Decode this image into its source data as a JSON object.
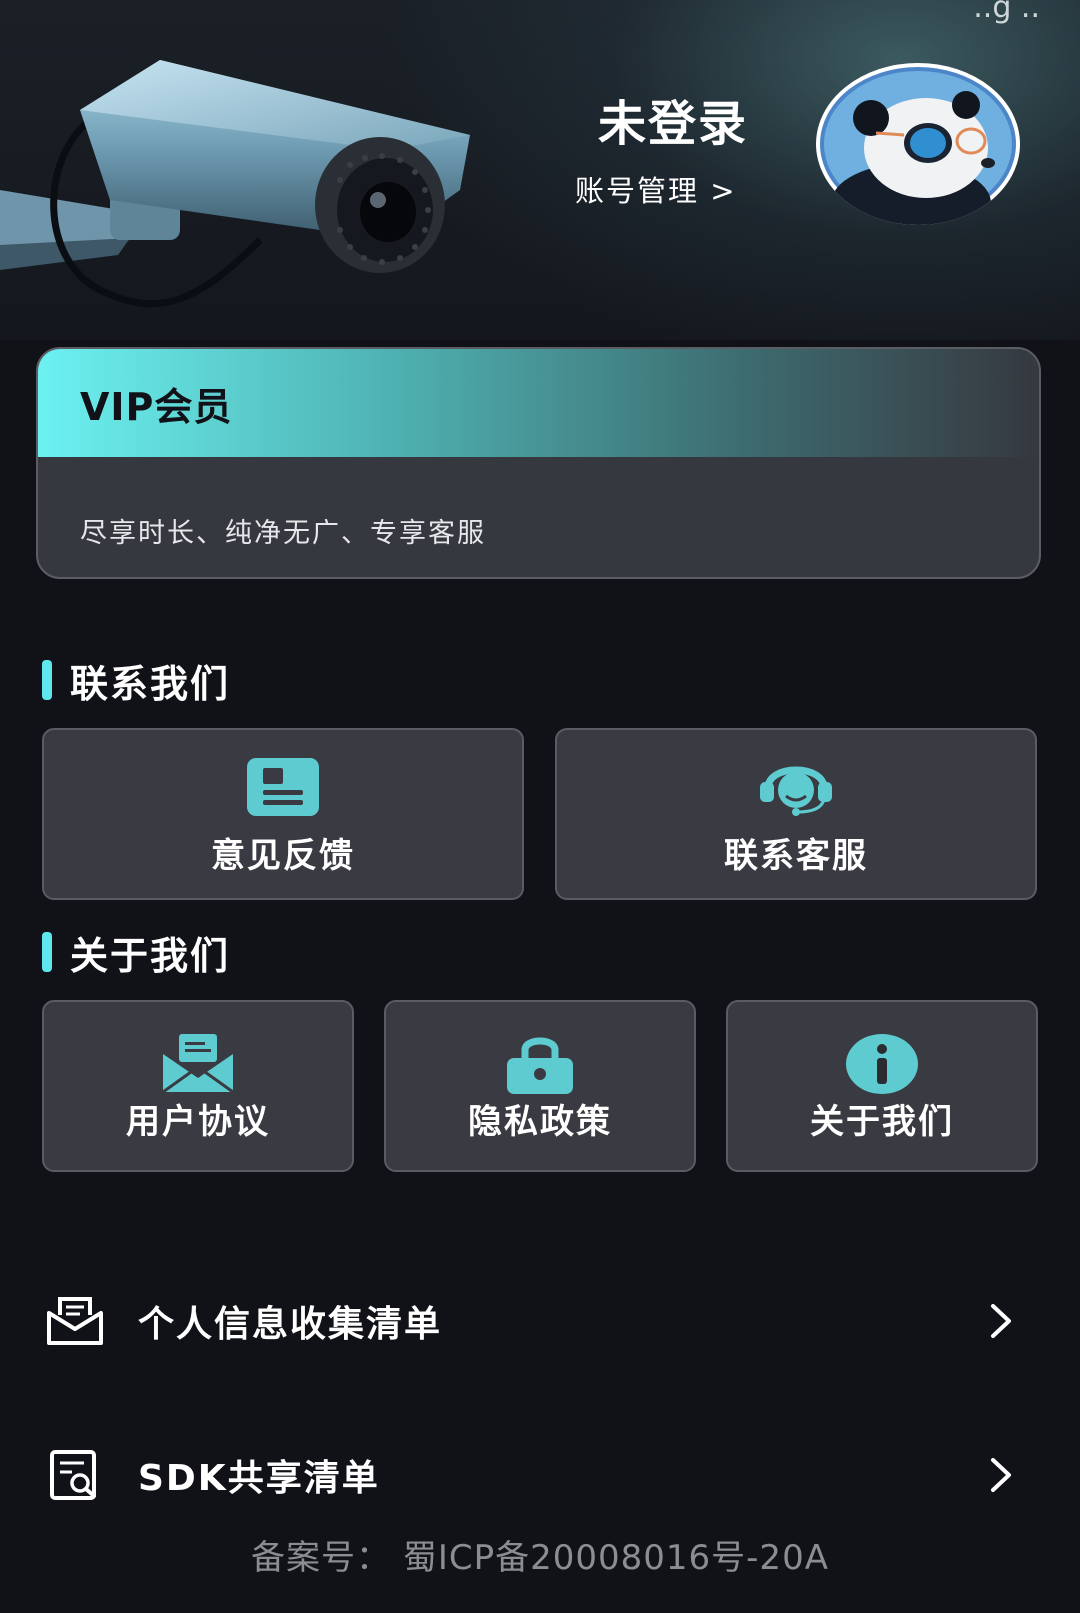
{
  "header": {
    "status_fragment": "..g ..",
    "login_status": "未登录",
    "account_link": "账号管理 >"
  },
  "vip": {
    "title": "VIP会员",
    "description": "尽享时长、纯净无广、专享客服"
  },
  "contact_section": {
    "title": "联系我们",
    "tiles": [
      {
        "label": "意见反馈",
        "icon": "feedback-icon"
      },
      {
        "label": "联系客服",
        "icon": "customer-service-icon"
      }
    ]
  },
  "about_section": {
    "title": "关于我们",
    "tiles": [
      {
        "label": "用户协议",
        "icon": "envelope-icon"
      },
      {
        "label": "隐私政策",
        "icon": "lock-icon"
      },
      {
        "label": "关于我们",
        "icon": "info-icon"
      }
    ]
  },
  "list": [
    {
      "label": "个人信息收集清单",
      "icon": "mail-list-icon"
    },
    {
      "label": "SDK共享清单",
      "icon": "search-document-icon"
    }
  ],
  "footer": {
    "icp": "备案号： 蜀ICP备20008016号-20A"
  },
  "colors": {
    "accent": "#5ee7ee",
    "background": "#111218",
    "tile_bg": "#3a3b42"
  }
}
